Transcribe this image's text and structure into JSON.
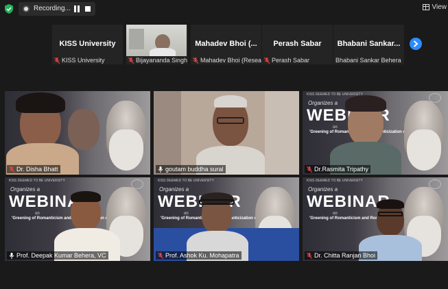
{
  "topbar": {
    "recording_label": "Recording...",
    "view_label": "View"
  },
  "filmstrip": [
    {
      "name": "KISS University",
      "label": "KISS University",
      "video": false
    },
    {
      "name": "",
      "label": "Bijayananda Singh",
      "video": true
    },
    {
      "name": "Mahadev  Bhoi  (...",
      "label": "Mahadev Bhoi (Resea...",
      "video": false
    },
    {
      "name": "Perash Sabar",
      "label": "Perash Sabar",
      "video": false
    },
    {
      "name": "Bhabani  Sankar...",
      "label": "Bhabani Sankar Behera",
      "video": false
    }
  ],
  "grid": [
    {
      "label": "Dr. Disha Bhatt",
      "muted": true
    },
    {
      "label": "goutam buddha sural",
      "muted": false
    },
    {
      "label": "Dr.Rasmita Tripathy",
      "muted": true
    },
    {
      "label": "Prof. Deepak Kumar Behera, VC",
      "muted": false,
      "active": true
    },
    {
      "label": "Prof. Ashok Ku. Mohapatra",
      "muted": true
    },
    {
      "label": "Dr. Chitta Ranjan Bhoi",
      "muted": true
    }
  ],
  "poster": {
    "college": "KISS DEEMED TO BE UNIVERSITY",
    "organises": "Organizes a",
    "title": "WEBINAR",
    "on": "on",
    "topic": "'Greening of Romanticism and Romanticization of Greenness'"
  },
  "colors": {
    "accent": "#2d8cff",
    "active_speaker": "#c8e060",
    "mic_muted": "#e04444",
    "background": "#1a1a1a"
  }
}
